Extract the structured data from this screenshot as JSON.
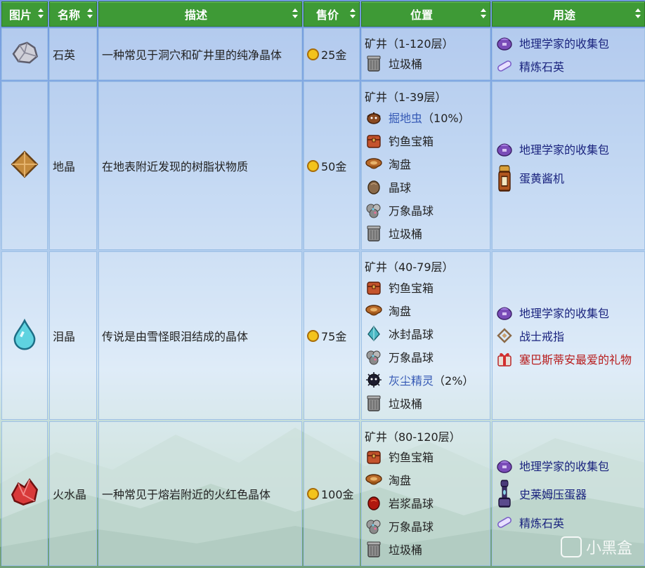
{
  "headers": [
    "图片",
    "名称",
    "描述",
    "售价",
    "位置",
    "用途"
  ],
  "rows": [
    {
      "name": "石英",
      "icon": "quartz-icon",
      "desc": "一种常见于洞穴和矿井里的纯净晶体",
      "price": "25金",
      "location_header": "矿井（1-120层）",
      "locations": [
        {
          "label": "垃圾桶",
          "icon": "trash-can-icon"
        }
      ],
      "uses": [
        {
          "label": "地理学家的收集包",
          "icon": "bundle-icon"
        },
        {
          "label": "精炼石英",
          "icon": "refined-quartz-icon"
        }
      ]
    },
    {
      "name": "地晶",
      "icon": "earth-crystal-icon",
      "desc": "在地表附近发现的树脂状物质",
      "price": "50金",
      "location_header": "矿井（1-39层）",
      "locations": [
        {
          "label": "掘地虫",
          "suffix": "（10%）",
          "icon": "duggy-icon",
          "link": true
        },
        {
          "label": "钓鱼宝箱",
          "icon": "fishing-chest-icon"
        },
        {
          "label": "淘盘",
          "icon": "pan-icon"
        },
        {
          "label": "晶球",
          "icon": "geode-icon"
        },
        {
          "label": "万象晶球",
          "icon": "omni-geode-icon"
        },
        {
          "label": "垃圾桶",
          "icon": "trash-can-icon"
        }
      ],
      "uses": [
        {
          "label": "地理学家的收集包",
          "icon": "bundle-icon"
        },
        {
          "label": "蛋黄酱机",
          "icon": "mayonnaise-machine-icon",
          "big": true
        }
      ]
    },
    {
      "name": "泪晶",
      "icon": "frozen-tear-icon",
      "desc": "传说是由雪怪眼泪结成的晶体",
      "price": "75金",
      "location_header": "矿井（40-79层）",
      "locations": [
        {
          "label": "钓鱼宝箱",
          "icon": "fishing-chest-icon"
        },
        {
          "label": "淘盘",
          "icon": "pan-icon"
        },
        {
          "label": "冰封晶球",
          "icon": "frozen-geode-icon"
        },
        {
          "label": "万象晶球",
          "icon": "omni-geode-icon"
        },
        {
          "label": "灰尘精灵",
          "suffix": "（2%）",
          "icon": "dust-sprite-icon",
          "link": true
        },
        {
          "label": "垃圾桶",
          "icon": "trash-can-icon"
        }
      ],
      "uses": [
        {
          "label": "地理学家的收集包",
          "icon": "bundle-icon"
        },
        {
          "label": "战士戒指",
          "icon": "warrior-ring-icon"
        },
        {
          "label": "塞巴斯蒂安最爱的礼物",
          "icon": "gift-icon",
          "red": true
        }
      ]
    },
    {
      "name": "火水晶",
      "icon": "fire-quartz-icon",
      "desc": "一种常见于熔岩附近的火红色晶体",
      "price": "100金",
      "location_header": "矿井（80-120层）",
      "locations": [
        {
          "label": "钓鱼宝箱",
          "icon": "fishing-chest-icon"
        },
        {
          "label": "淘盘",
          "icon": "pan-icon"
        },
        {
          "label": "岩浆晶球",
          "icon": "magma-geode-icon"
        },
        {
          "label": "万象晶球",
          "icon": "omni-geode-icon"
        },
        {
          "label": "垃圾桶",
          "icon": "trash-can-icon"
        }
      ],
      "uses": [
        {
          "label": "地理学家的收集包",
          "icon": "bundle-icon"
        },
        {
          "label": "史莱姆压蛋器",
          "icon": "slime-egg-press-icon",
          "big": true
        },
        {
          "label": "精炼石英",
          "icon": "refined-quartz-icon"
        }
      ]
    }
  ],
  "watermark": "小黑盒",
  "colors": {
    "header": "#3e9a36",
    "link": "#3559b5",
    "use_text": "#1a237e",
    "gift_text": "#b71c1c"
  }
}
